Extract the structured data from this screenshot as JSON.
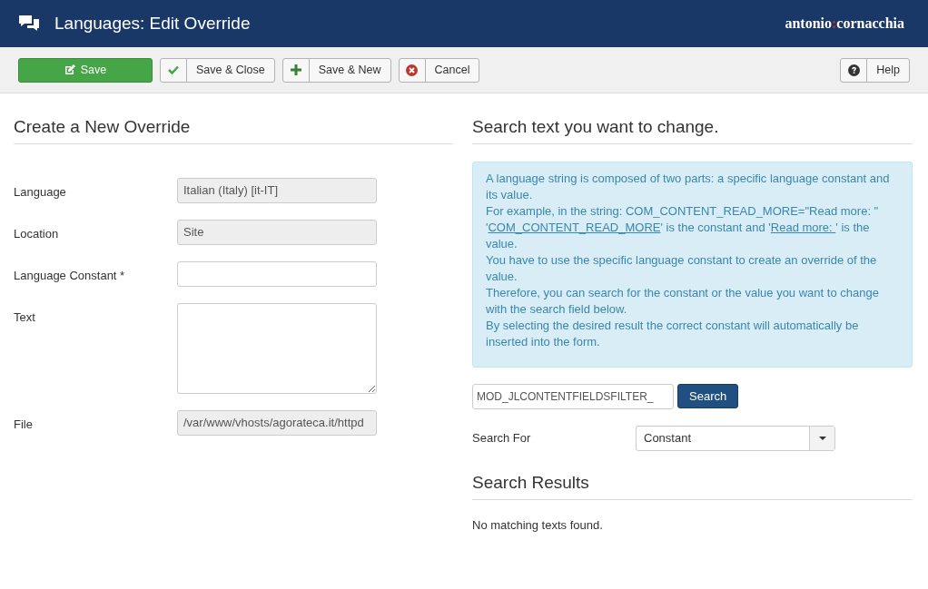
{
  "header": {
    "title": "Languages: Edit Override",
    "logo": {
      "before": "antonio",
      "mark": ":",
      "after": "cornacchia"
    }
  },
  "toolbar": {
    "buttons": [
      {
        "label": "Save",
        "kind": "primary"
      },
      {
        "label": "Save & Close",
        "kind": "default"
      },
      {
        "label": "Save & New",
        "kind": "default"
      },
      {
        "label": "Cancel",
        "kind": "default"
      }
    ],
    "help": {
      "label": "Help"
    }
  },
  "form": {
    "heading": "Create a New Override",
    "fields": [
      {
        "label": "Language",
        "kind": "input",
        "value": "Italian (Italy) [it-IT]",
        "disabled": true
      },
      {
        "label": "Location",
        "kind": "input",
        "value": "Site",
        "disabled": true
      },
      {
        "label": "Language Constant *",
        "kind": "input",
        "disabled": false
      },
      {
        "label": "Text",
        "kind": "textarea",
        "disabled": false
      },
      {
        "label": "File",
        "kind": "input",
        "value": "/var/www/vhosts/agorateca.it/httpd",
        "disabled": true
      }
    ]
  },
  "search": {
    "heading": "Search text you want to change.",
    "info": [
      [
        {
          "text": "A language string is composed of two parts: a specific language constant and its value."
        }
      ],
      [
        {
          "text": "For example, in the string: COM_CONTENT_READ_MORE=\"Read more: \" '"
        },
        {
          "text": "COM_CONTENT_READ_MORE",
          "link": true
        },
        {
          "text": "' is the constant and '"
        },
        {
          "text": "Read more: ",
          "link": true
        },
        {
          "text": "' is the value."
        }
      ],
      [
        {
          "text": "You have to use the specific language constant to create an override of the value."
        }
      ],
      [
        {
          "text": "Therefore, you can search for the constant or the value you want to change with the search field below."
        }
      ],
      [
        {
          "text": "By selecting the desired result the correct constant will automatically be inserted into the form."
        }
      ]
    ],
    "query": "MOD_JLCONTENTFIELDSFILTER_",
    "button": "Search",
    "search_for": {
      "label": "Search For",
      "value": "Constant"
    },
    "results_heading": "Search Results",
    "results_text": "No matching texts found."
  }
}
